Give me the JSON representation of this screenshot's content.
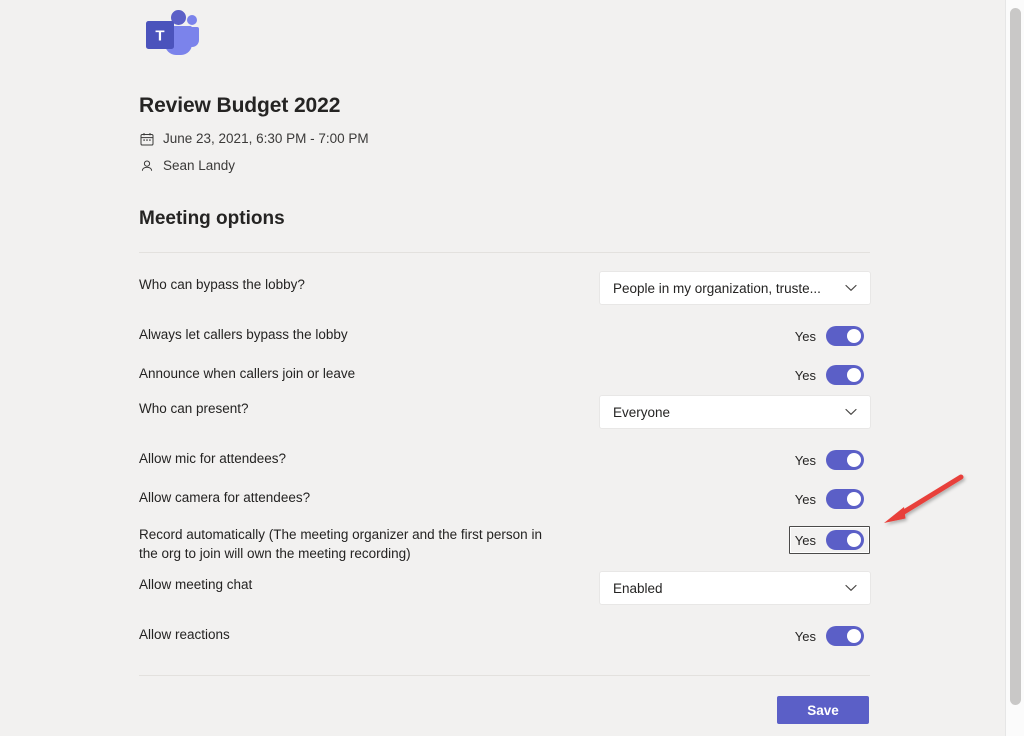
{
  "app": {
    "logo_icon": "microsoft-teams-logo",
    "logo_letter": "T"
  },
  "meeting": {
    "title": "Review Budget 2022",
    "datetime": "June 23, 2021, 6:30 PM - 7:00 PM",
    "date_icon": "calendar-icon",
    "organizer": "Sean Landy",
    "organizer_icon": "person-icon"
  },
  "section": {
    "heading": "Meeting options"
  },
  "options": [
    {
      "label": "Who can bypass the lobby?",
      "control": "dropdown",
      "value": "People in my organization, truste...",
      "icon": "chevron-down-icon"
    },
    {
      "label": "Always let callers bypass the lobby",
      "control": "toggle",
      "value": "Yes",
      "on": true,
      "focused": false
    },
    {
      "label": "Announce when callers join or leave",
      "control": "toggle",
      "value": "Yes",
      "on": true,
      "focused": false
    },
    {
      "label": "Who can present?",
      "control": "dropdown",
      "value": "Everyone",
      "icon": "chevron-down-icon"
    },
    {
      "label": "Allow mic for attendees?",
      "control": "toggle",
      "value": "Yes",
      "on": true,
      "focused": false
    },
    {
      "label": "Allow camera for attendees?",
      "control": "toggle",
      "value": "Yes",
      "on": true,
      "focused": false
    },
    {
      "label": "Record automatically (The meeting organizer and the first person in the org to join will own the meeting recording)",
      "control": "toggle",
      "value": "Yes",
      "on": true,
      "focused": true
    },
    {
      "label": "Allow meeting chat",
      "control": "dropdown",
      "value": "Enabled",
      "icon": "chevron-down-icon"
    },
    {
      "label": "Allow reactions",
      "control": "toggle",
      "value": "Yes",
      "on": true,
      "focused": false
    }
  ],
  "footer": {
    "save_label": "Save"
  },
  "annotation": {
    "type": "arrow",
    "color": "#e8403a",
    "points_to": "record-automatically-toggle"
  },
  "colors": {
    "accent": "#5b5fc7",
    "page_background": "#f2f1f0",
    "control_background": "#ffffff",
    "text": "#252423",
    "divider": "#e3e1de",
    "annotation_red": "#e8403a"
  },
  "scrollbar": {
    "name": "vertical-scrollbar"
  }
}
